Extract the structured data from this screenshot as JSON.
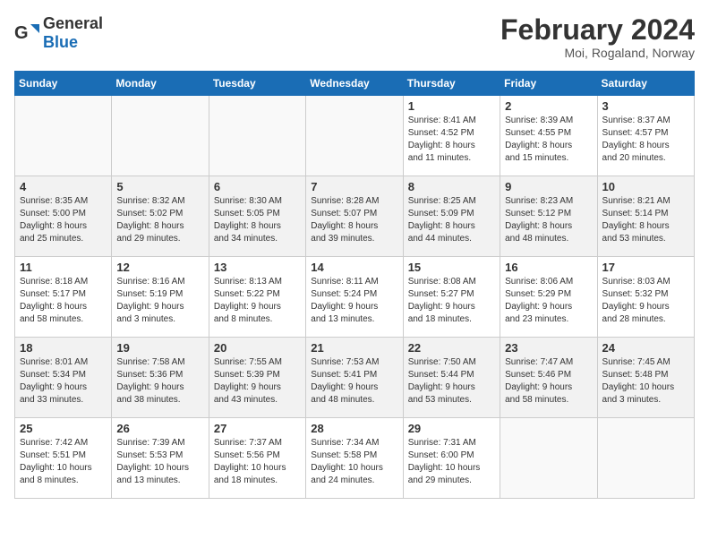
{
  "header": {
    "logo_general": "General",
    "logo_blue": "Blue",
    "title": "February 2024",
    "subtitle": "Moi, Rogaland, Norway"
  },
  "columns": [
    "Sunday",
    "Monday",
    "Tuesday",
    "Wednesday",
    "Thursday",
    "Friday",
    "Saturday"
  ],
  "weeks": [
    {
      "days": [
        {
          "num": "",
          "info": ""
        },
        {
          "num": "",
          "info": ""
        },
        {
          "num": "",
          "info": ""
        },
        {
          "num": "",
          "info": ""
        },
        {
          "num": "1",
          "info": "Sunrise: 8:41 AM\nSunset: 4:52 PM\nDaylight: 8 hours\nand 11 minutes."
        },
        {
          "num": "2",
          "info": "Sunrise: 8:39 AM\nSunset: 4:55 PM\nDaylight: 8 hours\nand 15 minutes."
        },
        {
          "num": "3",
          "info": "Sunrise: 8:37 AM\nSunset: 4:57 PM\nDaylight: 8 hours\nand 20 minutes."
        }
      ]
    },
    {
      "days": [
        {
          "num": "4",
          "info": "Sunrise: 8:35 AM\nSunset: 5:00 PM\nDaylight: 8 hours\nand 25 minutes."
        },
        {
          "num": "5",
          "info": "Sunrise: 8:32 AM\nSunset: 5:02 PM\nDaylight: 8 hours\nand 29 minutes."
        },
        {
          "num": "6",
          "info": "Sunrise: 8:30 AM\nSunset: 5:05 PM\nDaylight: 8 hours\nand 34 minutes."
        },
        {
          "num": "7",
          "info": "Sunrise: 8:28 AM\nSunset: 5:07 PM\nDaylight: 8 hours\nand 39 minutes."
        },
        {
          "num": "8",
          "info": "Sunrise: 8:25 AM\nSunset: 5:09 PM\nDaylight: 8 hours\nand 44 minutes."
        },
        {
          "num": "9",
          "info": "Sunrise: 8:23 AM\nSunset: 5:12 PM\nDaylight: 8 hours\nand 48 minutes."
        },
        {
          "num": "10",
          "info": "Sunrise: 8:21 AM\nSunset: 5:14 PM\nDaylight: 8 hours\nand 53 minutes."
        }
      ]
    },
    {
      "days": [
        {
          "num": "11",
          "info": "Sunrise: 8:18 AM\nSunset: 5:17 PM\nDaylight: 8 hours\nand 58 minutes."
        },
        {
          "num": "12",
          "info": "Sunrise: 8:16 AM\nSunset: 5:19 PM\nDaylight: 9 hours\nand 3 minutes."
        },
        {
          "num": "13",
          "info": "Sunrise: 8:13 AM\nSunset: 5:22 PM\nDaylight: 9 hours\nand 8 minutes."
        },
        {
          "num": "14",
          "info": "Sunrise: 8:11 AM\nSunset: 5:24 PM\nDaylight: 9 hours\nand 13 minutes."
        },
        {
          "num": "15",
          "info": "Sunrise: 8:08 AM\nSunset: 5:27 PM\nDaylight: 9 hours\nand 18 minutes."
        },
        {
          "num": "16",
          "info": "Sunrise: 8:06 AM\nSunset: 5:29 PM\nDaylight: 9 hours\nand 23 minutes."
        },
        {
          "num": "17",
          "info": "Sunrise: 8:03 AM\nSunset: 5:32 PM\nDaylight: 9 hours\nand 28 minutes."
        }
      ]
    },
    {
      "days": [
        {
          "num": "18",
          "info": "Sunrise: 8:01 AM\nSunset: 5:34 PM\nDaylight: 9 hours\nand 33 minutes."
        },
        {
          "num": "19",
          "info": "Sunrise: 7:58 AM\nSunset: 5:36 PM\nDaylight: 9 hours\nand 38 minutes."
        },
        {
          "num": "20",
          "info": "Sunrise: 7:55 AM\nSunset: 5:39 PM\nDaylight: 9 hours\nand 43 minutes."
        },
        {
          "num": "21",
          "info": "Sunrise: 7:53 AM\nSunset: 5:41 PM\nDaylight: 9 hours\nand 48 minutes."
        },
        {
          "num": "22",
          "info": "Sunrise: 7:50 AM\nSunset: 5:44 PM\nDaylight: 9 hours\nand 53 minutes."
        },
        {
          "num": "23",
          "info": "Sunrise: 7:47 AM\nSunset: 5:46 PM\nDaylight: 9 hours\nand 58 minutes."
        },
        {
          "num": "24",
          "info": "Sunrise: 7:45 AM\nSunset: 5:48 PM\nDaylight: 10 hours\nand 3 minutes."
        }
      ]
    },
    {
      "days": [
        {
          "num": "25",
          "info": "Sunrise: 7:42 AM\nSunset: 5:51 PM\nDaylight: 10 hours\nand 8 minutes."
        },
        {
          "num": "26",
          "info": "Sunrise: 7:39 AM\nSunset: 5:53 PM\nDaylight: 10 hours\nand 13 minutes."
        },
        {
          "num": "27",
          "info": "Sunrise: 7:37 AM\nSunset: 5:56 PM\nDaylight: 10 hours\nand 18 minutes."
        },
        {
          "num": "28",
          "info": "Sunrise: 7:34 AM\nSunset: 5:58 PM\nDaylight: 10 hours\nand 24 minutes."
        },
        {
          "num": "29",
          "info": "Sunrise: 7:31 AM\nSunset: 6:00 PM\nDaylight: 10 hours\nand 29 minutes."
        },
        {
          "num": "",
          "info": ""
        },
        {
          "num": "",
          "info": ""
        }
      ]
    }
  ]
}
